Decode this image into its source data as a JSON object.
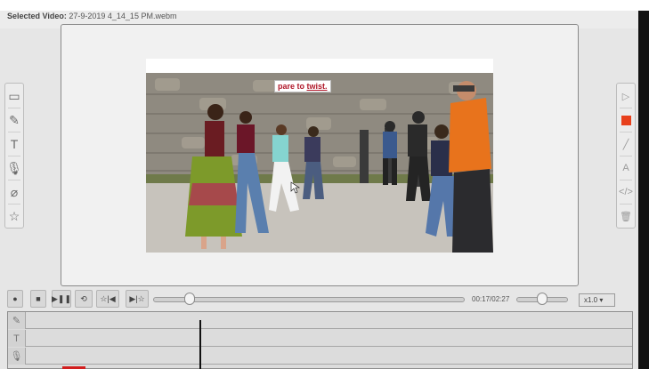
{
  "header": {
    "label": "Selected Video:",
    "filename": "27-9-2019 4_14_15 PM.webm"
  },
  "video": {
    "caption_prefix": "pare to ",
    "caption_word": "twist."
  },
  "left_tools": [
    {
      "name": "shape-icon",
      "glyph": "▭"
    },
    {
      "name": "pencil-icon",
      "glyph": "✎"
    },
    {
      "name": "text-icon",
      "glyph": "T"
    },
    {
      "name": "microphone-icon",
      "glyph": "🎙"
    },
    {
      "name": "eraser-icon",
      "glyph": "⌀"
    },
    {
      "name": "star-icon",
      "glyph": "☆"
    }
  ],
  "right_tools": [
    {
      "name": "cursor-icon",
      "glyph": "▷"
    },
    {
      "name": "color-swatch-icon",
      "glyph": ""
    },
    {
      "name": "line-icon",
      "glyph": "╱"
    },
    {
      "name": "text-box-icon",
      "glyph": "A"
    },
    {
      "name": "code-icon",
      "glyph": "</>"
    },
    {
      "name": "trash-icon",
      "glyph": "🗑"
    }
  ],
  "accent_color": "#e8401c",
  "player": {
    "buttons": [
      {
        "name": "record-button",
        "glyph": "●"
      },
      {
        "name": "stop-button",
        "glyph": "■"
      },
      {
        "name": "play-pause-button",
        "glyph": "▶❚❚"
      },
      {
        "name": "loop-button",
        "glyph": "⟲"
      },
      {
        "name": "previous-marker-button",
        "glyph": "☆|◀"
      },
      {
        "name": "next-marker-button",
        "glyph": "▶|☆"
      }
    ],
    "time": "00:17/02:27",
    "progress_fraction": 0.116,
    "volume_fraction": 0.5,
    "speed": "x1.0 ▾"
  },
  "timeline": {
    "tracks": [
      {
        "name": "pencil-track-icon",
        "glyph": "✎"
      },
      {
        "name": "text-track-icon",
        "glyph": "T"
      },
      {
        "name": "microphone-track-icon",
        "glyph": "🎙"
      }
    ]
  }
}
